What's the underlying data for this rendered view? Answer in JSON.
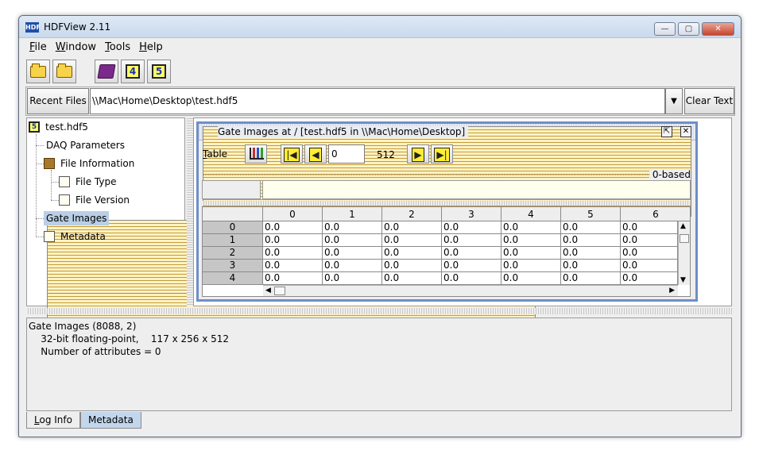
{
  "app": {
    "title": "HDFView 2.11",
    "icon_text": "HDF"
  },
  "window_controls": {
    "minimize": "—",
    "maximize": "▢",
    "close": "✕"
  },
  "menu": [
    {
      "label": "File",
      "mnemonic": "F",
      "rest": "ile"
    },
    {
      "label": "Window",
      "mnemonic": "W",
      "rest": "indow"
    },
    {
      "label": "Tools",
      "mnemonic": "T",
      "rest": "ools"
    },
    {
      "label": "Help",
      "mnemonic": "H",
      "rest": "elp"
    }
  ],
  "toolbar": {
    "open": "open-folder-icon",
    "close": "close-file-icon",
    "users_guide": "book-icon",
    "hdf4_text": "4",
    "hdf5_text": "5"
  },
  "urlbar": {
    "recent_label": "Recent Files",
    "url_value": "\\\\Mac\\Home\\Desktop\\test.hdf5",
    "dropdown": "▼",
    "clear_label": "Clear Text"
  },
  "tree": {
    "root_icon_text": "5",
    "root": "test.hdf5",
    "items": [
      "DAQ Parameters",
      "File Information",
      "File Type",
      "File Version",
      "Gate Images",
      "Metadata"
    ],
    "selected": "Gate Images"
  },
  "dataset_frame": {
    "title": "Gate Images  at  /  [test.hdf5  in  \\\\Mac\\Home\\Desktop]",
    "undock": "⇱",
    "close": "✕",
    "table_label": "Table",
    "table_mnemonic": "T",
    "table_rest": "able",
    "first_arrow": "|◀",
    "prev_arrow": "◀",
    "page_value": "0",
    "page_max": "512",
    "next_arrow": "▶",
    "last_arrow": "▶|",
    "index_base": "0-based",
    "columns": [
      "0",
      "1",
      "2",
      "3",
      "4",
      "5",
      "6"
    ],
    "rows": [
      {
        "index": "0",
        "cells": [
          "0.0",
          "0.0",
          "0.0",
          "0.0",
          "0.0",
          "0.0",
          "0.0"
        ]
      },
      {
        "index": "1",
        "cells": [
          "0.0",
          "0.0",
          "0.0",
          "0.0",
          "0.0",
          "0.0",
          "0.0"
        ]
      },
      {
        "index": "2",
        "cells": [
          "0.0",
          "0.0",
          "0.0",
          "0.0",
          "0.0",
          "0.0",
          "0.0"
        ]
      },
      {
        "index": "3",
        "cells": [
          "0.0",
          "0.0",
          "0.0",
          "0.0",
          "0.0",
          "0.0",
          "0.0"
        ]
      },
      {
        "index": "4",
        "cells": [
          "0.0",
          "0.0",
          "0.0",
          "0.0",
          "0.0",
          "0.0",
          "0.0"
        ]
      }
    ],
    "scroll_up": "▲",
    "scroll_down": "▼",
    "scroll_left": "◀",
    "scroll_right": "▶"
  },
  "info": {
    "line1": "Gate Images (8088, 2)",
    "line2": "    32-bit floating-point,    117 x 256 x 512",
    "line3": "    Number of attributes = 0"
  },
  "tabs": [
    {
      "label": "Log Info",
      "mnemonic": "L",
      "rest": "og Info",
      "active": true
    },
    {
      "label": "Metadata",
      "active": false
    }
  ]
}
